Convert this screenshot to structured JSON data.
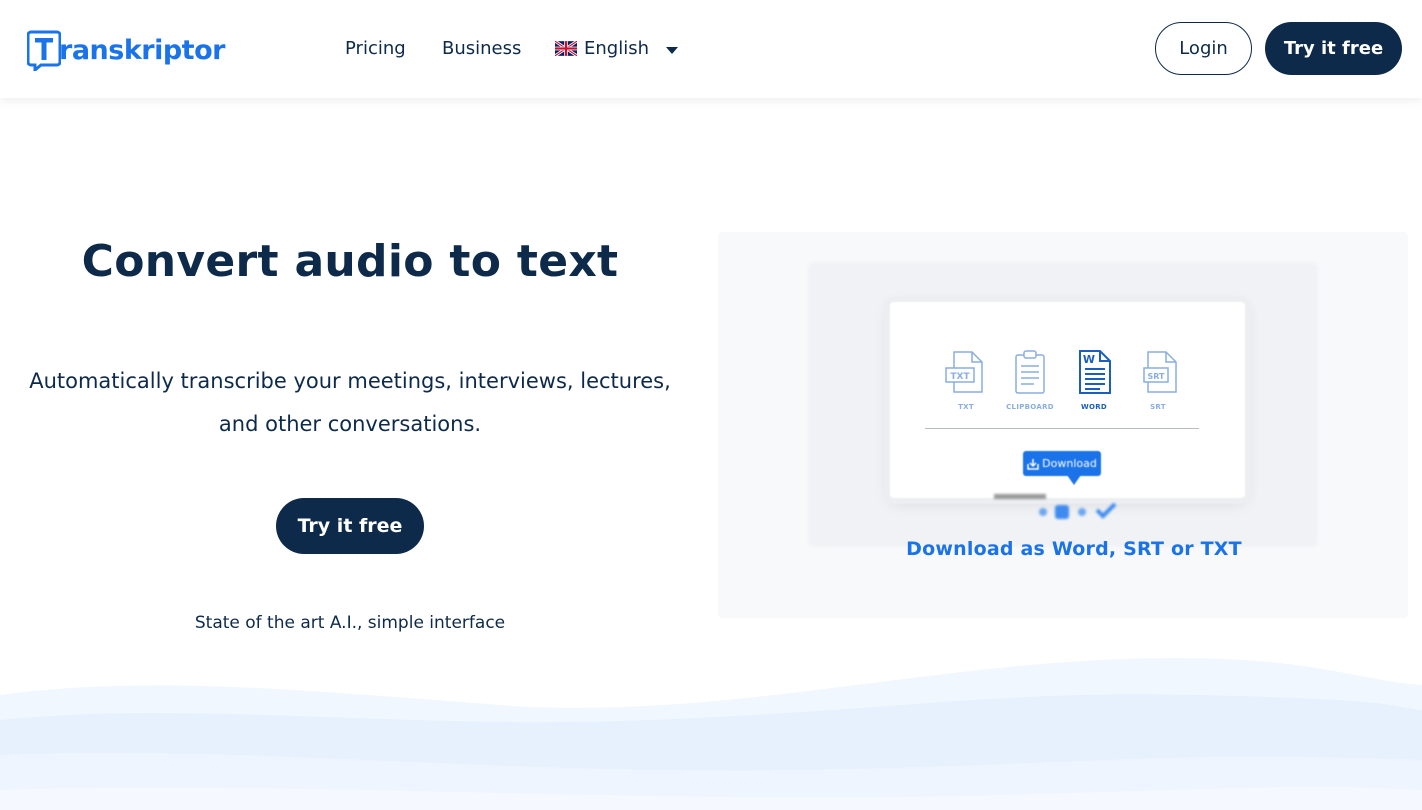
{
  "header": {
    "logo_text": "ranskriptor",
    "nav": {
      "pricing": "Pricing",
      "business": "Business"
    },
    "language": {
      "selected": "English",
      "flag_icon": "uk-flag-icon"
    },
    "login_label": "Login",
    "try_label": "Try it free"
  },
  "hero": {
    "title": "Convert audio to text",
    "subtitle": "Automatically transcribe your meetings, interviews, lectures, and other conversations.",
    "cta_label": "Try it free",
    "tagline": "State of the art A.I., simple interface"
  },
  "demo": {
    "formats": [
      {
        "icon_text": "TXT",
        "label": "TXT"
      },
      {
        "icon_text": "",
        "label": "CLIPBOARD"
      },
      {
        "icon_text": "W",
        "label": "WORD"
      },
      {
        "icon_text": "SRT",
        "label": "SRT"
      }
    ],
    "download_label": "Download",
    "caption": "Download as Word, SRT or TXT"
  },
  "colors": {
    "brand_blue": "#1a73e8",
    "navy": "#0d2a4a",
    "wave_light": "#e6f1fd"
  }
}
